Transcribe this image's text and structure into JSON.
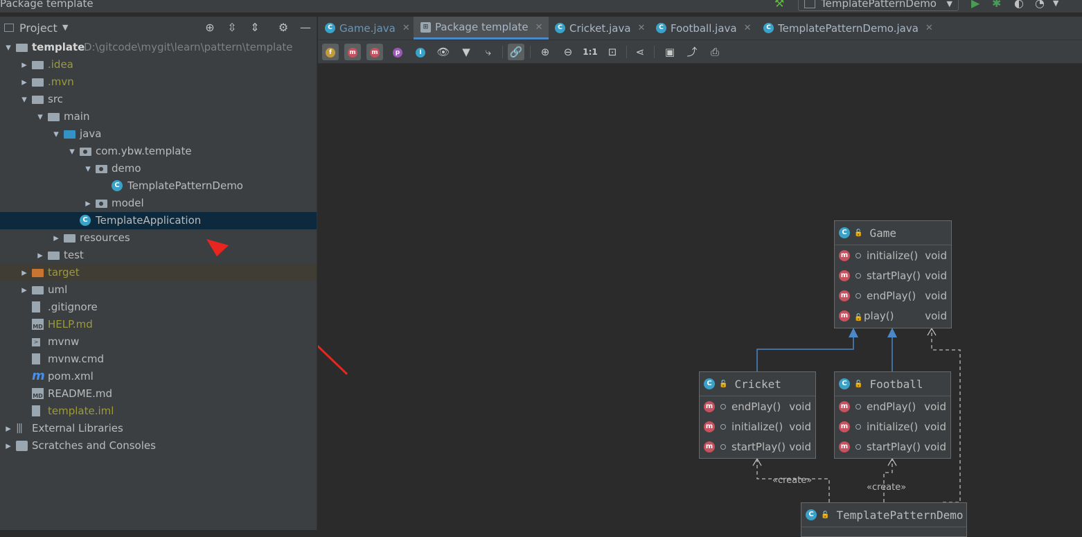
{
  "window_title": "Package template",
  "run_config": "TemplatePatternDemo",
  "project_panel": {
    "title": "Project",
    "tree": [
      {
        "label": "template",
        "path": "D:\\gitcode\\mygit\\learn\\pattern\\template",
        "arrow": "expanded",
        "icon": "module-folder-icon",
        "bold": true
      },
      {
        "label": ".idea",
        "arrow": "collapsed",
        "icon": "folder-icon",
        "olive": true
      },
      {
        "label": ".mvn",
        "arrow": "collapsed",
        "icon": "folder-icon",
        "olive": true
      },
      {
        "label": "src",
        "arrow": "expanded",
        "icon": "folder-icon"
      },
      {
        "label": "main",
        "arrow": "expanded",
        "icon": "folder-icon"
      },
      {
        "label": "java",
        "arrow": "expanded",
        "icon": "source-folder-icon"
      },
      {
        "label": "com.ybw.template",
        "arrow": "expanded",
        "icon": "package-icon"
      },
      {
        "label": "demo",
        "arrow": "expanded",
        "icon": "package-icon"
      },
      {
        "label": "TemplatePatternDemo",
        "arrow": "",
        "icon": "java-class-icon"
      },
      {
        "label": "model",
        "arrow": "collapsed",
        "icon": "package-icon"
      },
      {
        "label": "TemplateApplication",
        "arrow": "",
        "icon": "spring-boot-class-icon",
        "selected": true
      },
      {
        "label": "resources",
        "arrow": "collapsed",
        "icon": "resources-folder-icon"
      },
      {
        "label": "test",
        "arrow": "collapsed",
        "icon": "folder-icon"
      },
      {
        "label": "target",
        "arrow": "collapsed",
        "icon": "excluded-folder-icon",
        "olive": true,
        "excluded": true
      },
      {
        "label": "uml",
        "arrow": "collapsed",
        "icon": "folder-icon"
      },
      {
        "label": ".gitignore",
        "arrow": "",
        "icon": "gitignore-file-icon"
      },
      {
        "label": "HELP.md",
        "arrow": "",
        "icon": "markdown-file-icon",
        "olive": true
      },
      {
        "label": "mvnw",
        "arrow": "",
        "icon": "shell-script-icon"
      },
      {
        "label": "mvnw.cmd",
        "arrow": "",
        "icon": "text-file-icon"
      },
      {
        "label": "pom.xml",
        "arrow": "",
        "icon": "maven-icon"
      },
      {
        "label": "README.md",
        "arrow": "",
        "icon": "markdown-file-icon"
      },
      {
        "label": "template.iml",
        "arrow": "",
        "icon": "iml-file-icon",
        "olive": true
      },
      {
        "label": "External Libraries",
        "arrow": "collapsed",
        "icon": "library-icon"
      },
      {
        "label": "Scratches and Consoles",
        "arrow": "collapsed",
        "icon": "scratches-icon"
      }
    ]
  },
  "tabs": [
    {
      "label": "Game.java",
      "icon": "java-class-icon",
      "active": false,
      "blue": true
    },
    {
      "label": "Package template",
      "icon": "uml-diagram-icon",
      "active": true
    },
    {
      "label": "Cricket.java",
      "icon": "java-class-icon",
      "active": false
    },
    {
      "label": "Football.java",
      "icon": "java-class-icon",
      "active": false
    },
    {
      "label": "TemplatePatternDemo.java",
      "icon": "java-class-icon",
      "active": false
    }
  ],
  "toolbar_buttons": [
    "fields-toggle",
    "constructors-toggle",
    "methods-toggle",
    "properties-toggle",
    "inner-classes-toggle",
    "show-icon",
    "filter-icon",
    "edge-routing-icon",
    "link-icon",
    "zoom-in-icon",
    "zoom-out-icon",
    "actual-size-icon",
    "fit-content-icon",
    "layout-icon",
    "save-icon",
    "export-icon",
    "print-icon"
  ],
  "diagram": {
    "nodes": {
      "game": {
        "title": "Game",
        "methods": [
          {
            "name": "initialize()",
            "type": "void"
          },
          {
            "name": "startPlay()",
            "type": "void"
          },
          {
            "name": "endPlay()",
            "type": "void"
          },
          {
            "name": "play()",
            "type": "void"
          }
        ]
      },
      "cricket": {
        "title": "Cricket",
        "methods": [
          {
            "name": "endPlay()",
            "type": "void"
          },
          {
            "name": "initialize()",
            "type": "void"
          },
          {
            "name": "startPlay()",
            "type": "void"
          }
        ]
      },
      "football": {
        "title": "Football",
        "methods": [
          {
            "name": "endPlay()",
            "type": "void"
          },
          {
            "name": "initialize()",
            "type": "void"
          },
          {
            "name": "startPlay()",
            "type": "void"
          }
        ]
      },
      "demo": {
        "title": "TemplatePatternDemo"
      }
    },
    "create_label": "«create»"
  },
  "colors": {
    "annotation_arrow": "#e8261f",
    "inheritance": "#4a88c7",
    "dependency": "#bbbbbb"
  }
}
